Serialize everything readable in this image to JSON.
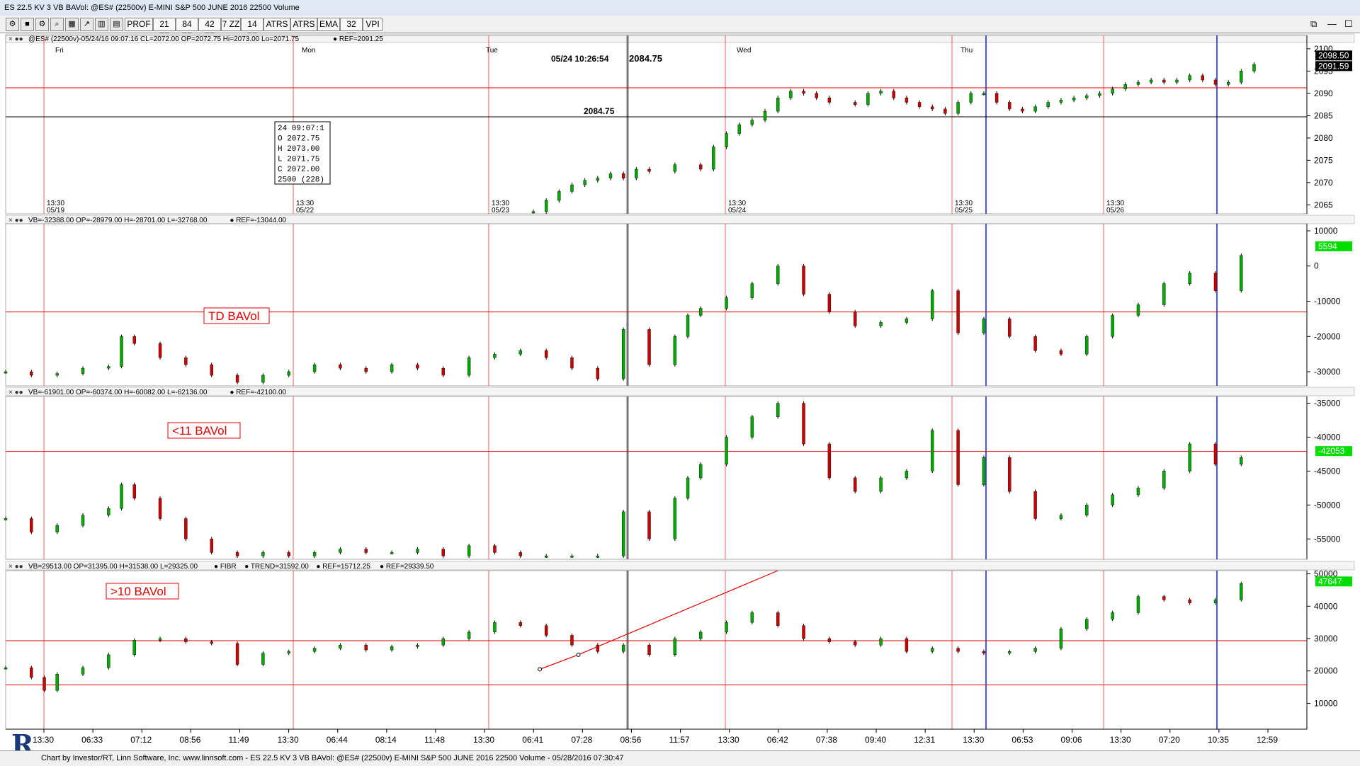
{
  "window": {
    "title": "ES 22.5 KV 3 VB BAVol: @ES# (22500v) E-MINI S&P 500 JUNE 2016 22500 Volume",
    "controls": [
      "⧉",
      "—",
      "☐"
    ]
  },
  "toolbar": {
    "buttons": [
      "PROF",
      "21 ZZ",
      "84 ZZ",
      "42 ZZ",
      "7 ZZ",
      "14 ZZ",
      "ATRS",
      "ATRS",
      "EMA",
      "32 ZZ",
      "VPI"
    ],
    "icons": [
      "gear-icon",
      "stop-icon",
      "gear2-icon",
      "zoom-icon",
      "chart-icon",
      "trend-icon",
      "bars-icon",
      "table-icon"
    ]
  },
  "footer": {
    "text": "Chart by Investor/RT, Linn Software, Inc. www.linnsoft.com - ES 22.5 KV 3 VB BAVol: @ES# (22500v) E-MINI S&P 500 JUNE 2016 22500 Volume - 05/28/2016 07:30:47",
    "logo": "R"
  },
  "colors": {
    "up": "#00aa00",
    "down": "#cc0000",
    "ref": "#e00000",
    "session": "#ff3030",
    "cursor": "#1020e0"
  },
  "cursor_readout": {
    "time": "05/24 10:26:54",
    "price": "2084.75",
    "hline_label": "2084.75"
  },
  "ohlc_box": [
    "24  09:07:1",
    "O   2072.75",
    "H   2073.00",
    "L   2071.75",
    "C   2072.00",
    "2500  (228)"
  ],
  "days": [
    "Fri",
    "Mon",
    "Tue",
    "Wed",
    "Thu"
  ],
  "session_dates": [
    "05/19",
    "05/22",
    "05/23",
    "05/24",
    "05/25",
    "05/26"
  ],
  "session_time": "13:30",
  "time_axis": [
    "13:30",
    "06:33",
    "07:12",
    "08:56",
    "11:49",
    "13:30",
    "06:44",
    "08:14",
    "11:48",
    "13:30",
    "06:41",
    "07:28",
    "08:56",
    "11:57",
    "13:30",
    "06:42",
    "07:38",
    "09:40",
    "12:31",
    "13:30",
    "06:53",
    "09:06",
    "13:30",
    "07:20",
    "10:35",
    "12:59"
  ],
  "chart_data": [
    {
      "type": "candlestick",
      "header": "@ES# (22500v)-05/24/16 09:07:16 CL=2072.00 OP=2072.75 Hi=2073.00 Lo=2071.75",
      "ref_label": "REF=2091.25",
      "ylim": [
        2063,
        2103
      ],
      "yticks": [
        "2100",
        "2095",
        "2090",
        "2085",
        "2080",
        "2075",
        "2070",
        "2065"
      ],
      "ref": 2091.25,
      "hline": 2084.75,
      "last": "2098.50",
      "tag2": "2091.59",
      "x": [
        0.41,
        0.42,
        0.43,
        0.44,
        0.45,
        0.46,
        0.47,
        0.48,
        0.49,
        0.5,
        0.52,
        0.54,
        0.55,
        0.56,
        0.57,
        0.58,
        0.59,
        0.6,
        0.61,
        0.62,
        0.63,
        0.64,
        0.66,
        0.67,
        0.68,
        0.69,
        0.7,
        0.71,
        0.72,
        0.73,
        0.74,
        0.75,
        0.76,
        0.77,
        0.78,
        0.79,
        0.8,
        0.81,
        0.82,
        0.83,
        0.84,
        0.85,
        0.86,
        0.87,
        0.88,
        0.89,
        0.9,
        0.91,
        0.92,
        0.93,
        0.94,
        0.95,
        0.96,
        0.97
      ],
      "close": [
        2063.5,
        2066,
        2068,
        2069.5,
        2070.5,
        2071,
        2072,
        2071,
        2073,
        2072.5,
        2074,
        2073,
        2078,
        2081,
        2083,
        2084,
        2086,
        2089,
        2090.5,
        2090,
        2089,
        2088,
        2087.5,
        2090,
        2090.5,
        2089,
        2088,
        2087,
        2086.5,
        2085.5,
        2088,
        2090,
        2090,
        2088,
        2086.5,
        2086,
        2087,
        2088,
        2088.5,
        2089,
        2089.5,
        2090,
        2091,
        2092,
        2092.5,
        2093,
        2092.5,
        2093,
        2094,
        2093,
        2092,
        2092.5,
        2095,
        2096.5
      ]
    },
    {
      "type": "candlestick",
      "name": "TD BAVol",
      "header": "VB=-32388.00 OP=-28979.00 H=-28701.00 L=-32768.00",
      "ref_label": "REF=-13044.00",
      "ylim": [
        -34000,
        12000
      ],
      "yticks": [
        "10000",
        "0",
        "-10000",
        "-20000",
        "-30000"
      ],
      "ref": -13044,
      "last": "5594",
      "x": [
        0.0,
        0.02,
        0.04,
        0.06,
        0.08,
        0.09,
        0.1,
        0.12,
        0.14,
        0.16,
        0.18,
        0.2,
        0.22,
        0.24,
        0.26,
        0.28,
        0.3,
        0.32,
        0.34,
        0.36,
        0.38,
        0.4,
        0.42,
        0.44,
        0.46,
        0.48,
        0.5,
        0.52,
        0.53,
        0.54,
        0.56,
        0.58,
        0.6,
        0.62,
        0.64,
        0.66,
        0.68,
        0.7,
        0.72,
        0.74,
        0.76,
        0.78,
        0.8,
        0.82,
        0.84,
        0.86,
        0.88,
        0.9,
        0.92,
        0.94,
        0.96
      ],
      "close": [
        -30000,
        -31000,
        -30500,
        -29000,
        -28500,
        -20000,
        -22000,
        -26000,
        -28000,
        -31000,
        -33000,
        -31000,
        -30000,
        -28000,
        -29000,
        -30000,
        -28000,
        -29000,
        -31000,
        -26000,
        -25000,
        -24000,
        -26000,
        -29000,
        -32000,
        -18000,
        -28000,
        -20000,
        -14000,
        -12000,
        -9000,
        -5000,
        0,
        -8000,
        -13000,
        -17000,
        -16000,
        -15000,
        -7000,
        -19000,
        -15000,
        -20000,
        -24000,
        -25000,
        -20000,
        -14000,
        -11000,
        -5000,
        -2000,
        -7000,
        3000
      ]
    },
    {
      "type": "candlestick",
      "name": "<11 BAVol",
      "header": "VB=-61901.00 OP=-60374.00 H=-60082.00 L=-62136.00",
      "ref_label": "REF=-42100.00",
      "ylim": [
        -58000,
        -34000
      ],
      "yticks": [
        "-35000",
        "-40000",
        "-45000",
        "-50000",
        "-55000"
      ],
      "ref": -42100,
      "last": "-42053",
      "x": [
        0.0,
        0.02,
        0.04,
        0.06,
        0.08,
        0.09,
        0.1,
        0.12,
        0.14,
        0.16,
        0.18,
        0.2,
        0.22,
        0.24,
        0.26,
        0.28,
        0.3,
        0.32,
        0.34,
        0.36,
        0.38,
        0.4,
        0.42,
        0.44,
        0.46,
        0.48,
        0.5,
        0.52,
        0.53,
        0.54,
        0.56,
        0.58,
        0.6,
        0.62,
        0.64,
        0.66,
        0.68,
        0.7,
        0.72,
        0.74,
        0.76,
        0.78,
        0.8,
        0.82,
        0.84,
        0.86,
        0.88,
        0.9,
        0.92,
        0.94,
        0.96
      ],
      "close": [
        -52000,
        -54000,
        -53000,
        -51500,
        -50500,
        -47000,
        -49000,
        -52000,
        -55000,
        -57000,
        -57500,
        -57000,
        -57500,
        -57000,
        -56500,
        -57000,
        -57000,
        -56500,
        -57500,
        -56000,
        -57000,
        -57500,
        -57500,
        -57500,
        -57500,
        -51000,
        -55000,
        -49000,
        -46000,
        -44000,
        -40000,
        -37000,
        -35000,
        -41000,
        -46000,
        -48000,
        -46000,
        -45000,
        -39000,
        -47000,
        -43000,
        -48000,
        -52000,
        -51500,
        -50000,
        -48500,
        -47500,
        -45000,
        -41000,
        -44000,
        -43000
      ]
    },
    {
      "type": "candlestick",
      "name": ">10 BAVol",
      "header": "VB=29513.00 OP=31395.00 H=31538.00 L=29325.00",
      "labels": [
        "FIBR",
        "TREND=31592.00",
        "REF=15712.25"
      ],
      "ref_label": "REF=29339.50",
      "ylim": [
        2000,
        51000
      ],
      "yticks": [
        "50000",
        "40000",
        "30000",
        "20000",
        "10000"
      ],
      "ref": 29339.5,
      "ref2": 15712.25,
      "last": "47647",
      "trend_points": [
        [
          0.415,
          20500
        ],
        [
          0.445,
          25000
        ],
        [
          0.6,
          51000
        ]
      ],
      "x": [
        0.0,
        0.02,
        0.03,
        0.04,
        0.06,
        0.08,
        0.1,
        0.12,
        0.14,
        0.16,
        0.18,
        0.2,
        0.22,
        0.24,
        0.26,
        0.28,
        0.3,
        0.32,
        0.34,
        0.36,
        0.38,
        0.4,
        0.42,
        0.44,
        0.46,
        0.48,
        0.5,
        0.52,
        0.54,
        0.56,
        0.58,
        0.6,
        0.62,
        0.64,
        0.66,
        0.68,
        0.7,
        0.72,
        0.74,
        0.76,
        0.78,
        0.8,
        0.82,
        0.84,
        0.86,
        0.88,
        0.9,
        0.92,
        0.94,
        0.96
      ],
      "close": [
        21000,
        18000,
        14000,
        19000,
        21000,
        25000,
        29500,
        30000,
        29000,
        28500,
        22000,
        25500,
        26000,
        27000,
        28000,
        26500,
        27500,
        28000,
        30000,
        32000,
        35000,
        34000,
        31000,
        28000,
        26000,
        28000,
        25000,
        30000,
        32000,
        35000,
        38000,
        34000,
        30000,
        29000,
        28000,
        30000,
        26000,
        27000,
        26000,
        25500,
        26000,
        27000,
        33000,
        36000,
        38000,
        43000,
        42000,
        41000,
        42000,
        47000
      ]
    }
  ]
}
